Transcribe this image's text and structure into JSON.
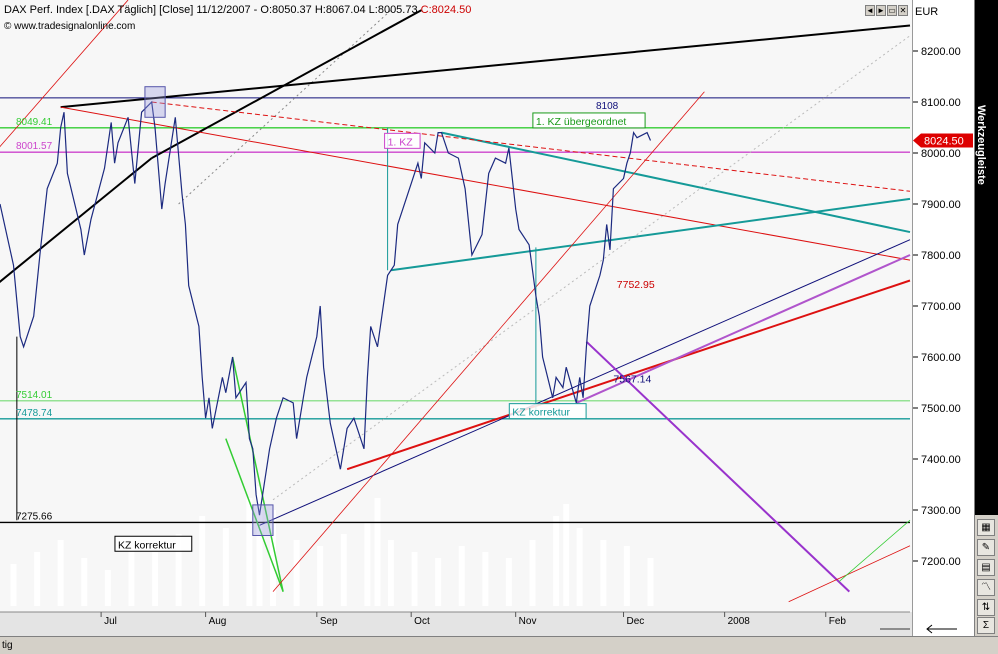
{
  "header": {
    "title": "DAX Perf. Index [.DAX  Täglich] [Close] 11/12/2007 - ",
    "ohlc_open": "O:8050.37",
    "ohlc_high": "H:8067.04",
    "ohlc_low": "L:8005.73",
    "ohlc_close": "C:8024.50",
    "copyright": "© www.tradesignalonline.com"
  },
  "window_buttons": [
    "◄",
    "►",
    "▭",
    "✕"
  ],
  "axis": {
    "currency": "EUR",
    "last_price_label": "8024.50"
  },
  "toolbox": {
    "title": "Werkzeugleiste",
    "icons": [
      "grid-icon",
      "wrench-icon",
      "page-icon",
      "chart-icon",
      "arrows-icon",
      "sigma-icon"
    ]
  },
  "statusbar": {
    "text": "tig"
  },
  "colors": {
    "price": "#1c2a80",
    "green": "#33cc33",
    "teal": "#159a98",
    "red": "#dd1111",
    "purple": "#9933cc",
    "magenta": "#cc55cc",
    "navy": "#10107a",
    "black": "#000000",
    "last_price": "#dd0000"
  },
  "chart_data": {
    "type": "line",
    "title": "DAX Perf. Index [.DAX  Täglich]",
    "ylabel": "EUR",
    "ylim": [
      7100,
      8300
    ],
    "y_ticks": [
      7200,
      7300,
      7400,
      7500,
      7600,
      7700,
      7800,
      7900,
      8000,
      8100,
      8200
    ],
    "x_ticks": [
      {
        "date": "2007-07-01",
        "label": "Jul"
      },
      {
        "date": "2007-08-01",
        "label": "Aug"
      },
      {
        "date": "2007-09-03",
        "label": "Sep"
      },
      {
        "date": "2007-10-01",
        "label": "Oct"
      },
      {
        "date": "2007-11-01",
        "label": "Nov"
      },
      {
        "date": "2007-12-03",
        "label": "Dec"
      },
      {
        "date": "2008-01-02",
        "label": "2008"
      },
      {
        "date": "2008-02-01",
        "label": "Feb"
      }
    ],
    "xlim": [
      "2007-06-01",
      "2008-02-26"
    ],
    "series": [
      {
        "name": "",
        "color": "#1c2a80",
        "points": [
          [
            "2007-06-01",
            7900
          ],
          [
            "2007-06-05",
            7780
          ],
          [
            "2007-06-07",
            7640
          ],
          [
            "2007-06-08",
            7620
          ],
          [
            "2007-06-11",
            7680
          ],
          [
            "2007-06-13",
            7810
          ],
          [
            "2007-06-15",
            7930
          ],
          [
            "2007-06-18",
            7980
          ],
          [
            "2007-06-19",
            8050
          ],
          [
            "2007-06-20",
            8080
          ],
          [
            "2007-06-21",
            7960
          ],
          [
            "2007-06-25",
            7850
          ],
          [
            "2007-06-26",
            7800
          ],
          [
            "2007-06-28",
            7870
          ],
          [
            "2007-07-02",
            7970
          ],
          [
            "2007-07-04",
            8060
          ],
          [
            "2007-07-05",
            7980
          ],
          [
            "2007-07-06",
            8020
          ],
          [
            "2007-07-09",
            8070
          ],
          [
            "2007-07-11",
            7940
          ],
          [
            "2007-07-13",
            8080
          ],
          [
            "2007-07-16",
            8100
          ],
          [
            "2007-07-17",
            8050
          ],
          [
            "2007-07-19",
            7890
          ],
          [
            "2007-07-20",
            7940
          ],
          [
            "2007-07-23",
            8070
          ],
          [
            "2007-07-25",
            7920
          ],
          [
            "2007-07-26",
            7860
          ],
          [
            "2007-07-27",
            7740
          ],
          [
            "2007-07-30",
            7660
          ],
          [
            "2007-07-31",
            7560
          ],
          [
            "2007-08-01",
            7480
          ],
          [
            "2007-08-02",
            7520
          ],
          [
            "2007-08-03",
            7460
          ],
          [
            "2007-08-06",
            7560
          ],
          [
            "2007-08-07",
            7530
          ],
          [
            "2007-08-09",
            7600
          ],
          [
            "2007-08-10",
            7520
          ],
          [
            "2007-08-13",
            7550
          ],
          [
            "2007-08-14",
            7440
          ],
          [
            "2007-08-15",
            7420
          ],
          [
            "2007-08-16",
            7330
          ],
          [
            "2007-08-17",
            7290
          ],
          [
            "2007-08-20",
            7420
          ],
          [
            "2007-08-22",
            7480
          ],
          [
            "2007-08-24",
            7520
          ],
          [
            "2007-08-27",
            7510
          ],
          [
            "2007-08-28",
            7440
          ],
          [
            "2007-08-30",
            7520
          ],
          [
            "2007-08-31",
            7560
          ],
          [
            "2007-09-03",
            7640
          ],
          [
            "2007-09-04",
            7700
          ],
          [
            "2007-09-05",
            7580
          ],
          [
            "2007-09-07",
            7470
          ],
          [
            "2007-09-10",
            7380
          ],
          [
            "2007-09-12",
            7460
          ],
          [
            "2007-09-14",
            7480
          ],
          [
            "2007-09-17",
            7420
          ],
          [
            "2007-09-18",
            7560
          ],
          [
            "2007-09-19",
            7660
          ],
          [
            "2007-09-21",
            7620
          ],
          [
            "2007-09-24",
            7760
          ],
          [
            "2007-09-26",
            7780
          ],
          [
            "2007-09-27",
            7860
          ],
          [
            "2007-09-28",
            7880
          ],
          [
            "2007-10-01",
            7940
          ],
          [
            "2007-10-03",
            7980
          ],
          [
            "2007-10-04",
            7950
          ],
          [
            "2007-10-05",
            8020
          ],
          [
            "2007-10-08",
            8000
          ],
          [
            "2007-10-09",
            8040
          ],
          [
            "2007-10-10",
            8040
          ],
          [
            "2007-10-12",
            8000
          ],
          [
            "2007-10-15",
            7990
          ],
          [
            "2007-10-17",
            7930
          ],
          [
            "2007-10-19",
            7800
          ],
          [
            "2007-10-22",
            7840
          ],
          [
            "2007-10-24",
            7960
          ],
          [
            "2007-10-26",
            7990
          ],
          [
            "2007-10-29",
            7980
          ],
          [
            "2007-10-30",
            8010
          ],
          [
            "2007-11-01",
            7890
          ],
          [
            "2007-11-02",
            7850
          ],
          [
            "2007-11-05",
            7820
          ],
          [
            "2007-11-07",
            7720
          ],
          [
            "2007-11-08",
            7680
          ],
          [
            "2007-11-09",
            7600
          ],
          [
            "2007-11-12",
            7520
          ],
          [
            "2007-11-13",
            7560
          ],
          [
            "2007-11-15",
            7540
          ],
          [
            "2007-11-16",
            7580
          ],
          [
            "2007-11-19",
            7510
          ],
          [
            "2007-11-20",
            7560
          ],
          [
            "2007-11-21",
            7520
          ],
          [
            "2007-11-22",
            7620
          ],
          [
            "2007-11-23",
            7700
          ],
          [
            "2007-11-26",
            7760
          ],
          [
            "2007-11-27",
            7790
          ],
          [
            "2007-11-28",
            7860
          ],
          [
            "2007-11-29",
            7810
          ],
          [
            "2007-11-30",
            7930
          ],
          [
            "2007-12-03",
            7950
          ],
          [
            "2007-12-04",
            7980
          ],
          [
            "2007-12-05",
            8000
          ],
          [
            "2007-12-06",
            8040
          ],
          [
            "2007-12-07",
            8030
          ],
          [
            "2007-12-10",
            8040
          ],
          [
            "2007-12-11",
            8024.5
          ]
        ]
      }
    ],
    "volume": {
      "color": "#ffffff",
      "values": [
        [
          "2007-06-05",
          0.35
        ],
        [
          "2007-06-12",
          0.45
        ],
        [
          "2007-06-19",
          0.55
        ],
        [
          "2007-06-26",
          0.4
        ],
        [
          "2007-07-03",
          0.3
        ],
        [
          "2007-07-10",
          0.5
        ],
        [
          "2007-07-17",
          0.45
        ],
        [
          "2007-07-24",
          0.6
        ],
        [
          "2007-07-31",
          0.75
        ],
        [
          "2007-08-07",
          0.65
        ],
        [
          "2007-08-14",
          0.9
        ],
        [
          "2007-08-17",
          1.0
        ],
        [
          "2007-08-21",
          0.8
        ],
        [
          "2007-08-28",
          0.55
        ],
        [
          "2007-09-04",
          0.5
        ],
        [
          "2007-09-11",
          0.6
        ],
        [
          "2007-09-18",
          0.7
        ],
        [
          "2007-09-21",
          0.9
        ],
        [
          "2007-09-25",
          0.55
        ],
        [
          "2007-10-02",
          0.45
        ],
        [
          "2007-10-09",
          0.4
        ],
        [
          "2007-10-16",
          0.5
        ],
        [
          "2007-10-23",
          0.45
        ],
        [
          "2007-10-30",
          0.4
        ],
        [
          "2007-11-06",
          0.55
        ],
        [
          "2007-11-13",
          0.75
        ],
        [
          "2007-11-16",
          0.85
        ],
        [
          "2007-11-20",
          0.65
        ],
        [
          "2007-11-27",
          0.55
        ],
        [
          "2007-12-04",
          0.5
        ],
        [
          "2007-12-11",
          0.4
        ]
      ]
    },
    "horizontal_levels": [
      {
        "value": 8108,
        "label": "8108",
        "color": "#10107a",
        "width": 1
      },
      {
        "value": 8049.41,
        "label": "8049.41",
        "color": "#33cc33",
        "width": 1.4
      },
      {
        "value": 8001.57,
        "label": "8001.57",
        "color": "#cc44cc",
        "width": 1.4
      },
      {
        "value": 7514.01,
        "label": "7514.01",
        "color": "#33cc33",
        "width": 0.8
      },
      {
        "value": 7478.74,
        "label": "7478.74",
        "color": "#159a98",
        "width": 1.4
      },
      {
        "value": 7275.66,
        "label": "7275.66",
        "color": "#000000",
        "width": 1.4
      }
    ],
    "trendlines": [
      {
        "from": [
          "2007-05-25",
          7710
        ],
        "to": [
          "2007-07-16",
          7990
        ],
        "color": "#000000",
        "width": 2
      },
      {
        "from": [
          "2007-07-16",
          7990
        ],
        "to": [
          "2007-10-04",
          8280
        ],
        "color": "#000000",
        "width": 2
      },
      {
        "from": [
          "2007-06-19",
          8090
        ],
        "to": [
          "2008-02-26",
          8250
        ],
        "color": "#000000",
        "width": 2
      },
      {
        "from": [
          "2007-06-19",
          8090
        ],
        "to": [
          "2008-02-26",
          7790
        ],
        "color": "#dd1111",
        "width": 1
      },
      {
        "from": [
          "2007-10-10",
          8040
        ],
        "to": [
          "2008-02-26",
          7845
        ],
        "color": "#159a98",
        "width": 2
      },
      {
        "from": [
          "2007-09-25",
          7770
        ],
        "to": [
          "2008-02-26",
          7910
        ],
        "color": "#159a98",
        "width": 2
      },
      {
        "from": [
          "2007-09-12",
          7380
        ],
        "to": [
          "2008-02-26",
          7750
        ],
        "color": "#dd1111",
        "width": 2
      },
      {
        "from": [
          "2007-11-19",
          7510
        ],
        "to": [
          "2008-02-26",
          7800
        ],
        "color": "#b055cc",
        "width": 2
      },
      {
        "from": [
          "2007-08-17",
          7270
        ],
        "to": [
          "2008-02-26",
          7830
        ],
        "color": "#10107a",
        "width": 1
      },
      {
        "from": [
          "2007-11-22",
          7630
        ],
        "to": [
          "2008-02-08",
          7140
        ],
        "color": "#9933cc",
        "width": 2
      },
      {
        "from": [
          "2007-08-09",
          7600
        ],
        "to": [
          "2007-08-24",
          7140
        ],
        "color": "#33cc33",
        "width": 1.5
      },
      {
        "from": [
          "2007-08-07",
          7440
        ],
        "to": [
          "2007-08-24",
          7140
        ],
        "color": "#33cc33",
        "width": 1.5
      },
      {
        "from": [
          "2007-08-21",
          7140
        ],
        "to": [
          "2007-12-27",
          8120
        ],
        "color": "#dd1111",
        "width": 0.8
      },
      {
        "from": [
          "2007-05-29",
          7990
        ],
        "to": [
          "2007-07-09",
          8300
        ],
        "color": "#dd1111",
        "width": 0.8
      },
      {
        "from": [
          "2008-01-21",
          7120
        ],
        "to": [
          "2008-02-26",
          7230
        ],
        "color": "#dd1111",
        "width": 0.8
      },
      {
        "from": [
          "2008-02-05",
          7160
        ],
        "to": [
          "2008-02-26",
          7280
        ],
        "color": "#33cc33",
        "width": 0.8
      }
    ],
    "dashed_lines": [
      {
        "from": [
          "2007-07-16",
          8100
        ],
        "to": [
          "2008-02-26",
          7925
        ],
        "color": "#dd1111"
      }
    ],
    "dotted_lines": [
      {
        "from": [
          "2007-08-21",
          7320
        ],
        "to": [
          "2008-02-26",
          8230
        ],
        "color": "#bbbbbb"
      },
      {
        "from": [
          "2007-07-24",
          7900
        ],
        "to": [
          "2007-09-25",
          8280
        ],
        "color": "#888888"
      }
    ],
    "vertical_markers": [
      {
        "x": "2007-09-24",
        "from": 8050,
        "to": 7770,
        "color": "#159a98"
      },
      {
        "x": "2007-11-07",
        "from": 7815,
        "to": 7490,
        "color": "#159a98"
      },
      {
        "x": "2007-06-06",
        "from": 7640,
        "to": 7280,
        "color": "#000000"
      }
    ],
    "marker_boxes": [
      {
        "from": [
          "2007-07-14",
          8130
        ],
        "to": [
          "2007-07-20",
          8070
        ]
      },
      {
        "from": [
          "2007-08-15",
          7310
        ],
        "to": [
          "2007-08-21",
          7250
        ]
      }
    ],
    "annotations": [
      {
        "text": "1. KZ übergeordnet",
        "at": [
          "2007-11-07",
          8055
        ],
        "color": "#1a9a1a",
        "boxed": true
      },
      {
        "text": "1. KZ",
        "at": [
          "2007-09-24",
          8015
        ],
        "color": "#cc44cc",
        "boxed": true
      },
      {
        "text": "KZ korrektur",
        "at": [
          "2007-10-31",
          7485
        ],
        "color": "#159a98",
        "boxed": true
      },
      {
        "text": "KZ korrektur",
        "at": [
          "2007-07-06",
          7225
        ],
        "color": "#000000",
        "boxed": true
      },
      {
        "text": "7752.95",
        "at": [
          "2007-12-01",
          7735
        ],
        "color": "#cc0000",
        "boxed": false
      },
      {
        "text": "7567.14",
        "at": [
          "2007-11-30",
          7550
        ],
        "color": "#10107a",
        "boxed": false
      }
    ],
    "last_price": 8024.5,
    "grid": false,
    "legend": "none"
  }
}
